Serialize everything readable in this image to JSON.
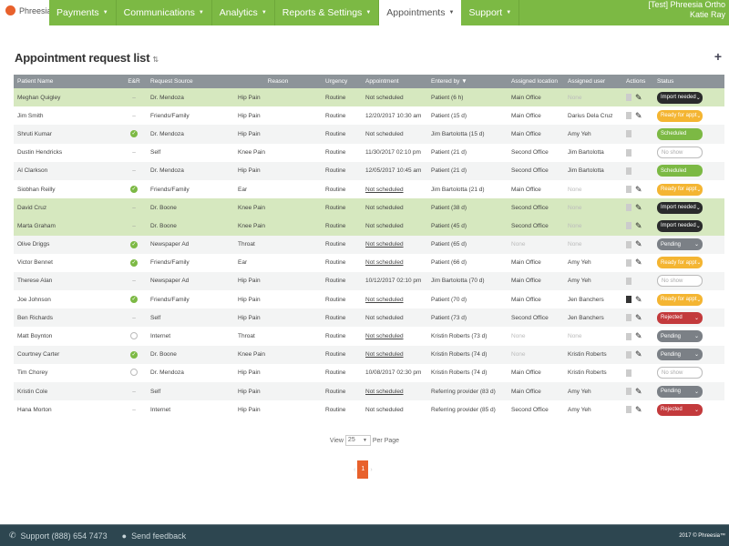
{
  "brand": {
    "name": "Phreesia",
    "color": "#e8612c"
  },
  "nav": {
    "items": [
      {
        "label": "Payments"
      },
      {
        "label": "Communications"
      },
      {
        "label": "Analytics"
      },
      {
        "label": "Reports & Settings"
      },
      {
        "label": "Appointments",
        "active": true
      },
      {
        "label": "Support"
      }
    ],
    "accent": "#7cb944"
  },
  "user": {
    "org": "[Test] Phreesia Ortho",
    "name": "Katie Ray"
  },
  "page": {
    "title": "Appointment request list",
    "title_icon": "sort-icon",
    "add_icon": "plus-icon"
  },
  "table": {
    "columns": [
      "Patient Name",
      "E&R",
      "Request Source",
      "Reason",
      "Urgency",
      "Appointment",
      "Entered by ▼",
      "Assigned location",
      "Assigned user",
      "Actions",
      "Status"
    ],
    "rows": [
      {
        "name": "Meghan Quigley",
        "er": "dash",
        "source": "Dr. Mendoza",
        "reason": "Hip Pain",
        "urgency": "Routine",
        "appointment": "Not scheduled",
        "appt_link": false,
        "entered": "Patient (6 h)",
        "location": "Main Office",
        "user": "None",
        "edit": true,
        "doc_dark": false,
        "status": "Import needed",
        "highlight": true
      },
      {
        "name": "Jim Smith",
        "er": "dash",
        "source": "Friends/Family",
        "reason": "Hip Pain",
        "urgency": "Routine",
        "appointment": "12/20/2017 10:30 am",
        "appt_link": false,
        "entered": "Patient (15 d)",
        "location": "Main Office",
        "user": "Darius Dela Cruz",
        "edit": true,
        "doc_dark": false,
        "status": "Ready for appt"
      },
      {
        "name": "Shruti Kumar",
        "er": "check",
        "source": "Dr. Mendoza",
        "reason": "Hip Pain",
        "urgency": "Routine",
        "appointment": "Not scheduled",
        "appt_link": false,
        "entered": "Jim Bartolotta (15 d)",
        "location": "Main Office",
        "user": "Amy Yeh",
        "edit": false,
        "doc_dark": false,
        "status": "Scheduled"
      },
      {
        "name": "Dustin Hendricks",
        "er": "dash",
        "source": "Self",
        "reason": "Knee Pain",
        "urgency": "Routine",
        "appointment": "11/30/2017 02:10 pm",
        "appt_link": false,
        "entered": "Patient (21 d)",
        "location": "Second Office",
        "user": "Jim Bartolotta",
        "edit": false,
        "doc_dark": false,
        "status": "No show"
      },
      {
        "name": "Al Clarkson",
        "er": "dash",
        "source": "Dr. Mendoza",
        "reason": "Hip Pain",
        "urgency": "Routine",
        "appointment": "12/05/2017 10:45 am",
        "appt_link": false,
        "entered": "Patient (21 d)",
        "location": "Second Office",
        "user": "Jim Bartolotta",
        "edit": false,
        "doc_dark": false,
        "status": "Scheduled"
      },
      {
        "name": "Siobhan Reilly",
        "er": "check",
        "source": "Friends/Family",
        "reason": "Ear",
        "urgency": "Routine",
        "appointment": "Not scheduled",
        "appt_link": true,
        "entered": "Jim Bartolotta (21 d)",
        "location": "Main Office",
        "user": "None",
        "edit": true,
        "doc_dark": false,
        "status": "Ready for appt"
      },
      {
        "name": "David Cruz",
        "er": "dash",
        "source": "Dr. Boone",
        "reason": "Knee Pain",
        "urgency": "Routine",
        "appointment": "Not scheduled",
        "appt_link": false,
        "entered": "Patient (38 d)",
        "location": "Second Office",
        "user": "None",
        "edit": true,
        "doc_dark": false,
        "status": "Import needed",
        "highlight": true
      },
      {
        "name": "Marta Graham",
        "er": "dash",
        "source": "Dr. Boone",
        "reason": "Knee Pain",
        "urgency": "Routine",
        "appointment": "Not scheduled",
        "appt_link": false,
        "entered": "Patient (45 d)",
        "location": "Second Office",
        "user": "None",
        "edit": true,
        "doc_dark": false,
        "status": "Import needed",
        "highlight": true
      },
      {
        "name": "Olive Driggs",
        "er": "check",
        "source": "Newspaper Ad",
        "reason": "Throat",
        "urgency": "Routine",
        "appointment": "Not scheduled",
        "appt_link": true,
        "entered": "Patient (65 d)",
        "location": "None",
        "user": "None",
        "edit": true,
        "doc_dark": false,
        "status": "Pending"
      },
      {
        "name": "Victor Bennet",
        "er": "check",
        "source": "Friends/Family",
        "reason": "Ear",
        "urgency": "Routine",
        "appointment": "Not scheduled",
        "appt_link": true,
        "entered": "Patient (66 d)",
        "location": "Main Office",
        "user": "Amy Yeh",
        "edit": true,
        "doc_dark": false,
        "status": "Ready for appt"
      },
      {
        "name": "Therese Alan",
        "er": "dash",
        "source": "Newspaper Ad",
        "reason": "Hip Pain",
        "urgency": "Routine",
        "appointment": "10/12/2017 02:10 pm",
        "appt_link": false,
        "entered": "Jim Bartolotta (70 d)",
        "location": "Main Office",
        "user": "Amy Yeh",
        "edit": false,
        "doc_dark": false,
        "status": "No show"
      },
      {
        "name": "Joe Johnson",
        "er": "check",
        "source": "Friends/Family",
        "reason": "Hip Pain",
        "urgency": "Routine",
        "appointment": "Not scheduled",
        "appt_link": true,
        "entered": "Patient (70 d)",
        "location": "Main Office",
        "user": "Jen Banchers",
        "edit": true,
        "doc_dark": true,
        "status": "Ready for appt"
      },
      {
        "name": "Ben Richards",
        "er": "dash",
        "source": "Self",
        "reason": "Hip Pain",
        "urgency": "Routine",
        "appointment": "Not scheduled",
        "appt_link": false,
        "entered": "Patient (73 d)",
        "location": "Second Office",
        "user": "Jen Banchers",
        "edit": true,
        "doc_dark": false,
        "status": "Rejected"
      },
      {
        "name": "Matt Boynton",
        "er": "circle",
        "source": "Internet",
        "reason": "Throat",
        "urgency": "Routine",
        "appointment": "Not scheduled",
        "appt_link": true,
        "entered": "Kristin Roberts (73 d)",
        "location": "None",
        "user": "None",
        "edit": true,
        "doc_dark": false,
        "status": "Pending"
      },
      {
        "name": "Courtney Carter",
        "er": "check",
        "source": "Dr. Boone",
        "reason": "Knee Pain",
        "urgency": "Routine",
        "appointment": "Not scheduled",
        "appt_link": true,
        "entered": "Kristin Roberts (74 d)",
        "location": "None",
        "user": "Kristin Roberts",
        "edit": true,
        "doc_dark": false,
        "status": "Pending"
      },
      {
        "name": "Tim Chorey",
        "er": "circle",
        "source": "Dr. Mendoza",
        "reason": "Hip Pain",
        "urgency": "Routine",
        "appointment": "10/08/2017 02:30 pm",
        "appt_link": false,
        "entered": "Kristin Roberts (74 d)",
        "location": "Main Office",
        "user": "Kristin Roberts",
        "edit": false,
        "doc_dark": false,
        "status": "No show"
      },
      {
        "name": "Kristin Cole",
        "er": "dash",
        "source": "Self",
        "reason": "Hip Pain",
        "urgency": "Routine",
        "appointment": "Not scheduled",
        "appt_link": true,
        "entered": "Referring provider (83 d)",
        "location": "Main Office",
        "user": "Amy Yeh",
        "edit": true,
        "doc_dark": false,
        "status": "Pending"
      },
      {
        "name": "Hana Morton",
        "er": "dash",
        "source": "Internet",
        "reason": "Hip Pain",
        "urgency": "Routine",
        "appointment": "Not scheduled",
        "appt_link": false,
        "entered": "Referring provider (85 d)",
        "location": "Second Office",
        "user": "Amy Yeh",
        "edit": true,
        "doc_dark": false,
        "status": "Rejected"
      }
    ]
  },
  "status_colors": {
    "Import needed": "#2a2b2c",
    "Ready for appt": "#f4b532",
    "Scheduled": "#7cb944",
    "No show": "#ffffff",
    "Pending": "#7b8086",
    "Rejected": "#c33a3c"
  },
  "pagination": {
    "view_label": "View",
    "per_page_value": "25",
    "per_page_label": "Per Page",
    "prev": "‹",
    "current": "1",
    "next": "›"
  },
  "footer": {
    "support": "Support (888) 654 7473",
    "feedback": "Send feedback",
    "copyright": "2017 © Phreesia™"
  }
}
